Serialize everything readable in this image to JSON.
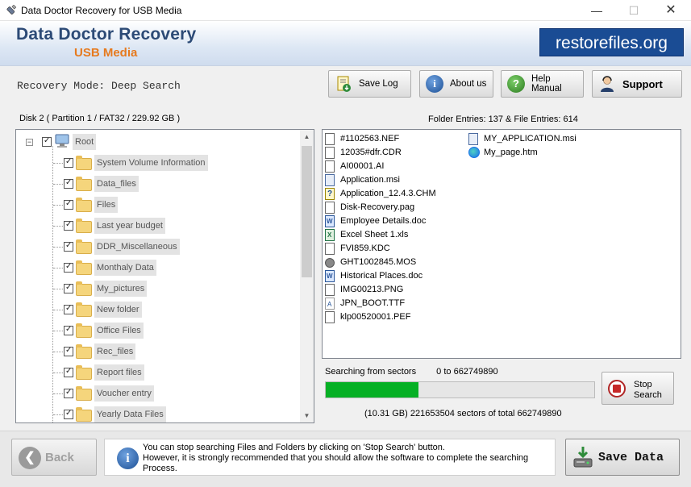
{
  "window": {
    "title": "Data Doctor Recovery for USB Media",
    "minimize_glyph": "—",
    "maximize_glyph": "☐",
    "close_glyph": "✕"
  },
  "header": {
    "brand_main": "Data Doctor Recovery",
    "brand_sub": "USB Media",
    "site": "restorefiles.org"
  },
  "toolbar": {
    "mode": "Recovery Mode: Deep Search",
    "save_log": "Save Log",
    "about_us": "About us",
    "help_manual": "Help Manual",
    "support": "Support"
  },
  "disk_info": "Disk 2 ( Partition 1 / FAT32 / 229.92 GB )",
  "entries_info": "Folder Entries: 137 & File Entries: 614",
  "tree": {
    "root": "Root",
    "collapse_glyph": "−",
    "folders": [
      "System Volume Information",
      "Data_files",
      "Files",
      "Last year budget",
      "DDR_Miscellaneous",
      "Monthaly Data",
      "My_pictures",
      "New folder",
      "Office Files",
      "Rec_files",
      "Report files",
      "Voucher entry",
      "Yearly Data Files"
    ],
    "scroll_up": "▲",
    "scroll_down": "▼"
  },
  "files_col1": [
    {
      "name": "#1102563.NEF",
      "icon": "file-icon"
    },
    {
      "name": "12035#dfr.CDR",
      "icon": "file-icon"
    },
    {
      "name": "AI00001.AI",
      "icon": "file-icon"
    },
    {
      "name": "Application.msi",
      "icon": "msi-icon"
    },
    {
      "name": "Application_12.4.3.CHM",
      "icon": "help-file-icon"
    },
    {
      "name": "Disk-Recovery.pag",
      "icon": "file-icon"
    },
    {
      "name": "Employee Details.doc",
      "icon": "word-icon"
    },
    {
      "name": "Excel Sheet 1.xls",
      "icon": "excel-icon"
    },
    {
      "name": "FVI859.KDC",
      "icon": "file-icon"
    },
    {
      "name": "GHT1002845.MOS",
      "icon": "gear-icon"
    },
    {
      "name": "Historical Places.doc",
      "icon": "word-icon"
    },
    {
      "name": "IMG00213.PNG",
      "icon": "file-icon"
    },
    {
      "name": "JPN_BOOT.TTF",
      "icon": "font-icon"
    },
    {
      "name": "klp00520001.PEF",
      "icon": "file-icon"
    }
  ],
  "files_col2": [
    {
      "name": "MY_APPLICATION.msi",
      "icon": "msi-icon"
    },
    {
      "name": "My_page.htm",
      "icon": "edge-icon"
    }
  ],
  "progress": {
    "label_prefix": "Searching from sectors",
    "range": "0 to 662749890",
    "fraction": 0.345,
    "sectors_text": "(10.31 GB) 221653504   sectors  of  total 662749890",
    "stop_label": "Stop Search"
  },
  "bottom": {
    "back": "Back",
    "message_lines": [
      "You can stop searching Files and Folders by clicking on 'Stop Search' button.",
      "However, it is strongly recommended that you should allow the software to complete the searching",
      "Process."
    ],
    "save": "Save Data"
  },
  "colors": {
    "brand_blue": "#2c4a76",
    "brand_orange": "#e67a1e",
    "progress_green": "#06b025",
    "stop_red": "#c62828"
  }
}
